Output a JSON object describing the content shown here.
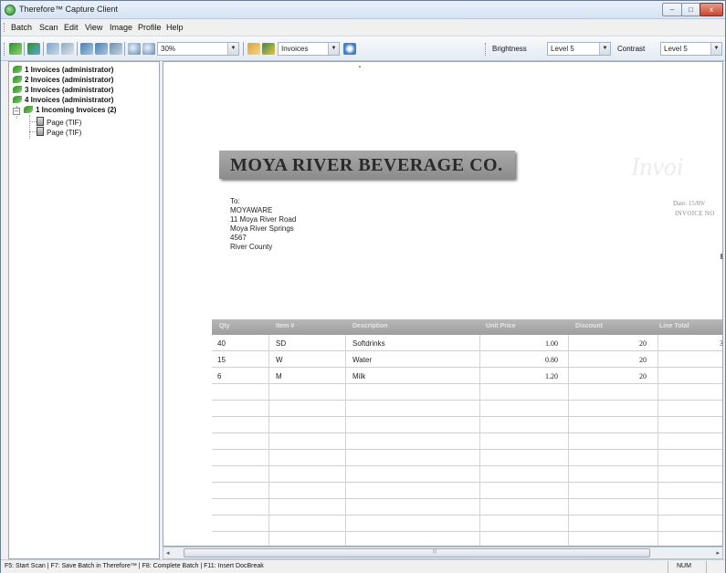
{
  "window": {
    "title": "Therefore™ Capture Client",
    "controls": {
      "minimize": "–",
      "maximize": "□",
      "close": "x"
    }
  },
  "menu": [
    "Batch",
    "Scan",
    "Edit",
    "View",
    "Image",
    "Profile",
    "Help"
  ],
  "toolbar": {
    "zoom_value": "30%",
    "profile_value": "Invoices",
    "brightness_label": "Brightness",
    "brightness_value": "Level 5",
    "contrast_label": "Contrast",
    "contrast_value": "Level 5"
  },
  "tree": {
    "items": [
      {
        "label": "1 Invoices (administrator)"
      },
      {
        "label": "2 Invoices (administrator)"
      },
      {
        "label": "3 Invoices (administrator)"
      },
      {
        "label": "4 Invoices (administrator)"
      },
      {
        "label": "1 Incoming Invoices (2)"
      },
      {
        "label": "Page (TIF)"
      },
      {
        "label": "Page (TIF)"
      }
    ],
    "expander": "–"
  },
  "document": {
    "company": "MOYA RIVER BEVERAGE CO.",
    "ghost_title": "Invoi",
    "to_lines": [
      "To:",
      "MOYAWARE",
      "11 Moya River Road",
      "Moya River Springs",
      "4567",
      "River County"
    ],
    "date": "Date: 15/09/",
    "invoice_no": "INVOICE NO",
    "table": {
      "headers": [
        "Qty",
        "Item #",
        "Description",
        "Unit Price",
        "Discount",
        "Line Total"
      ],
      "rows": [
        {
          "qty": "40",
          "item": "SD",
          "desc": "Softdrinks",
          "price": "1.00",
          "discount": "20",
          "total": "3"
        },
        {
          "qty": "15",
          "item": "W",
          "desc": "Water",
          "price": "0.80",
          "discount": "20",
          "total": ""
        },
        {
          "qty": "6",
          "item": "M",
          "desc": "Milk",
          "price": "1.20",
          "discount": "20",
          "total": ""
        }
      ]
    }
  },
  "scroll": {
    "left": "◂",
    "right": "▸",
    "grip": "⦙⦙⦙"
  },
  "status": {
    "text": "F5: Start Scan | F7: Save Batch in Therefore™ | F8: Complete Batch | F11: Insert DocBreak",
    "num": "NUM"
  },
  "colors": {
    "banner": "#9a9a9a",
    "table_header": "#a8a8a8",
    "tree_icon": "#2e8a2c"
  }
}
